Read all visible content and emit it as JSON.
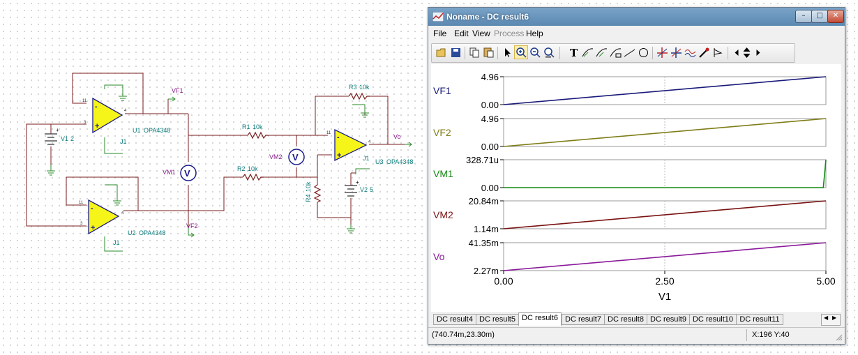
{
  "schematic": {
    "components": {
      "u1": {
        "name": "U1",
        "model": "OPA4348"
      },
      "u2": {
        "name": "U2",
        "model": "OPA4348"
      },
      "u3": {
        "name": "U3",
        "model": "OPA4348"
      },
      "r1": {
        "name": "R1",
        "value": "10k"
      },
      "r2": {
        "name": "R2",
        "value": "10k"
      },
      "r3": {
        "name": "R3",
        "value": "10k"
      },
      "r4": {
        "name": "R4",
        "value": "10k"
      },
      "v1": {
        "name": "V1",
        "value": "2"
      },
      "v2": {
        "name": "V2",
        "value": "5"
      },
      "vm1": "VM1",
      "vm2": "VM2",
      "vf1": "VF1",
      "vf2": "VF2",
      "vo": "Vo",
      "j1": "J1",
      "meter_symbol": "V",
      "pins": {
        "p11": "11",
        "p3": "3",
        "p4": "4",
        "p2": "2",
        "p1": "1",
        "plus": "+",
        "minus": "-"
      }
    }
  },
  "window": {
    "title": "Noname - DC result6",
    "icon": "tina-chart-icon",
    "controls": {
      "minimize": "–",
      "maximize": "□",
      "close": "✕"
    }
  },
  "menu": [
    {
      "label": "File",
      "enabled": true
    },
    {
      "label": "Edit",
      "enabled": true
    },
    {
      "label": "View",
      "enabled": true
    },
    {
      "label": "Process",
      "enabled": false
    },
    {
      "label": "Help",
      "enabled": true
    }
  ],
  "toolbar": {
    "buttons": [
      "open-icon",
      "save-icon",
      "copy-icon",
      "paste-icon",
      "pointer-icon",
      "zoom-in-icon",
      "zoom-out-icon",
      "zoom-fit-icon",
      "text-icon",
      "curve-tool-icon",
      "curve-tool-2-icon",
      "curve-tool-3-icon",
      "line-icon",
      "circle-icon",
      "cursor-a-icon",
      "cursor-b-icon",
      "waveform-icon",
      "probe-icon",
      "marker-icon",
      "scroll-left-icon",
      "scroll-updown-icon",
      "scroll-right-icon"
    ],
    "text_button": "T"
  },
  "chart_data": {
    "type": "line",
    "xlabel": "V1",
    "x_ticks": [
      "0.00",
      "2.50",
      "5.00"
    ],
    "xlim": [
      0,
      5
    ],
    "grid": "dashed",
    "series": [
      {
        "name": "VF1",
        "color": "#1a1a7a",
        "ymax_label": "4.96",
        "ymin_label": "0.00",
        "x": [
          0,
          5
        ],
        "y": [
          0,
          4.96
        ]
      },
      {
        "name": "VF2",
        "color": "#7f7d17",
        "ymax_label": "4.96",
        "ymin_label": "0.00",
        "x": [
          0,
          5
        ],
        "y": [
          0,
          4.96
        ]
      },
      {
        "name": "VM1",
        "color": "#138a13",
        "ymax_label": "328.71u",
        "ymin_label": "0.00",
        "x": [
          0,
          4.96,
          5
        ],
        "y": [
          0,
          0,
          328.71
        ]
      },
      {
        "name": "VM2",
        "color": "#7a1212",
        "ymax_label": "20.84m",
        "ymin_label": "1.14m",
        "x": [
          0,
          5
        ],
        "y": [
          1.14,
          20.84
        ]
      },
      {
        "name": "Vo",
        "color": "#8a1a9a",
        "ymax_label": "41.35m",
        "ymin_label": "2.27m",
        "x": [
          0,
          5
        ],
        "y": [
          2.27,
          41.35
        ]
      }
    ]
  },
  "tabs": [
    {
      "label": "DC result4",
      "selected": false
    },
    {
      "label": "DC result5",
      "selected": false
    },
    {
      "label": "DC result6",
      "selected": true
    },
    {
      "label": "DC result7",
      "selected": false
    },
    {
      "label": "DC result8",
      "selected": false
    },
    {
      "label": "DC result9",
      "selected": false
    },
    {
      "label": "DC result10",
      "selected": false
    },
    {
      "label": "DC result11",
      "selected": false
    }
  ],
  "tab_nav": {
    "left": "◀",
    "right": "▶"
  },
  "status": {
    "coords": "(740.74m,23.30m)",
    "xy": "X:196  Y:40"
  }
}
